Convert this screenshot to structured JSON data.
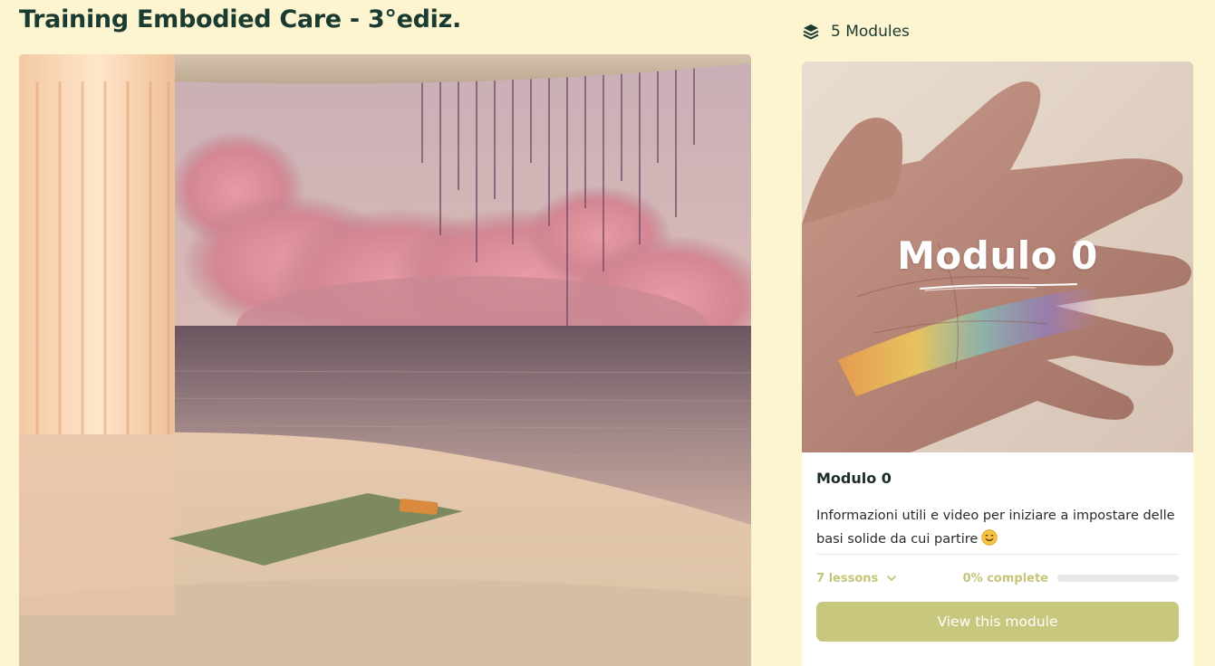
{
  "course": {
    "title": "Training Embodied Care - 3°ediz."
  },
  "sidebar": {
    "modules_count_label": "5 Modules",
    "modules_icon": "layers-icon"
  },
  "module_card": {
    "thumbnail_title": "Modulo 0",
    "name": "Modulo 0",
    "description": "Informazioni utili e video per iniziare a impostare delle basi solide da cui partire",
    "description_emoji": "smiling-face-icon",
    "lessons_label": "7 lessons",
    "lessons_icon": "chevron-down-icon",
    "progress_label": "0% complete",
    "progress_fraction": 0,
    "button_label": "View this module"
  },
  "colors": {
    "background": "#fdf5cf",
    "title_text": "#1a3b32",
    "accent_olive": "#c7c77d",
    "card_background": "#ffffff"
  }
}
